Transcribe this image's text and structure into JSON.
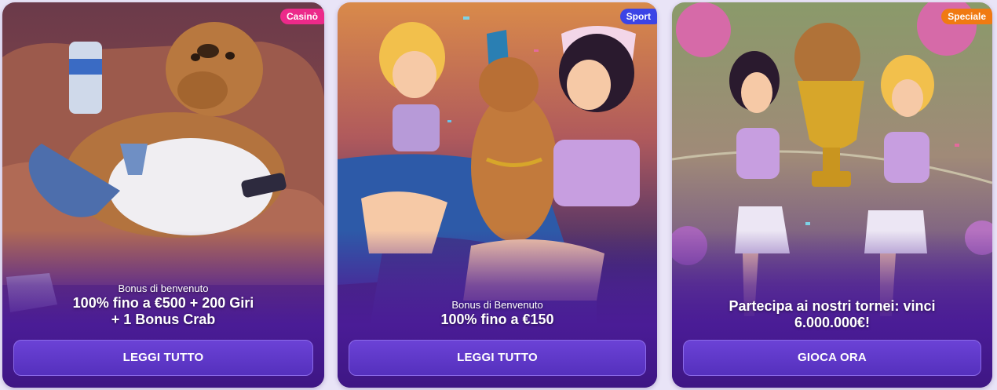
{
  "cards": [
    {
      "badge": "Casinò",
      "subtitle": "Bonus di benvenuto",
      "title_line1": "100% fino a €500 + 200 Giri",
      "title_line2": "+ 1 Bonus Crab",
      "button": "LEGGI TUTTO"
    },
    {
      "badge": "Sport",
      "subtitle": "Bonus di Benvenuto",
      "title_line1": "100% fino a €150",
      "button": "LEGGI TUTTO"
    },
    {
      "badge": "Speciale",
      "title_line1": "Partecipa ai nostri tornei: vinci",
      "title_line2": "6.000.000€!",
      "button": "GIOCA ORA"
    }
  ],
  "colors": {
    "page_bg": "#e9e4f7",
    "button_bg": "#5f38cc",
    "casino_badge": "#ec2a8a",
    "sport_badge": "#3b44e6",
    "special_badge": "#f07a12"
  }
}
